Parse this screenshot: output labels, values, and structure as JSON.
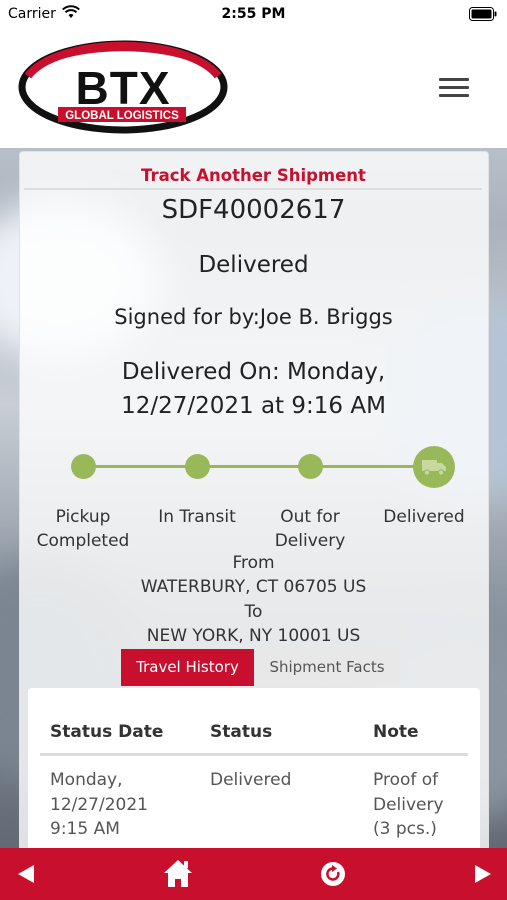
{
  "status_bar": {
    "carrier": "Carrier",
    "time": "2:55 PM",
    "icons": [
      "wifi-icon",
      "battery-icon"
    ]
  },
  "header": {
    "logo_text": "BTX",
    "logo_subtext": "GLOBAL LOGISTICS",
    "menu_icon": "hamburger-menu-icon"
  },
  "shipment": {
    "track_another_label": "Track Another Shipment",
    "tracking_number": "SDF40002617",
    "status": "Delivered",
    "signed_for": "Signed for by:Joe B. Briggs",
    "delivered_on_line1": "Delivered On: Monday,",
    "delivered_on_line2": "12/27/2021 at 9:16 AM"
  },
  "progress": {
    "current_step_index": 3,
    "steps": [
      {
        "line1": "Pickup",
        "line2": "Completed"
      },
      {
        "line1": "In Transit",
        "line2": ""
      },
      {
        "line1": "Out for",
        "line2": "Delivery"
      },
      {
        "line1": "Delivered",
        "line2": ""
      }
    ]
  },
  "route": {
    "from_label": "From",
    "origin": "WATERBURY, CT 06705 US",
    "to_label": "To",
    "destination": "NEW YORK, NY 10001 US"
  },
  "tabs": {
    "active": "Travel History",
    "inactive": "Shipment Facts"
  },
  "history_table": {
    "headers": [
      "Status Date",
      "Status",
      "Note"
    ],
    "rows": [
      {
        "date_lines": [
          "Monday,",
          "12/27/2021",
          "9:15 AM"
        ],
        "status": "Delivered",
        "note_lines": [
          "Proof of",
          "Delivery",
          "(3 pcs.)"
        ]
      }
    ]
  },
  "bottom_bar": {
    "buttons": [
      "back-arrow-icon",
      "home-icon",
      "refresh-icon",
      "forward-arrow-icon"
    ]
  },
  "colors": {
    "brand_red": "#c8102e",
    "progress_green": "#98b859"
  }
}
